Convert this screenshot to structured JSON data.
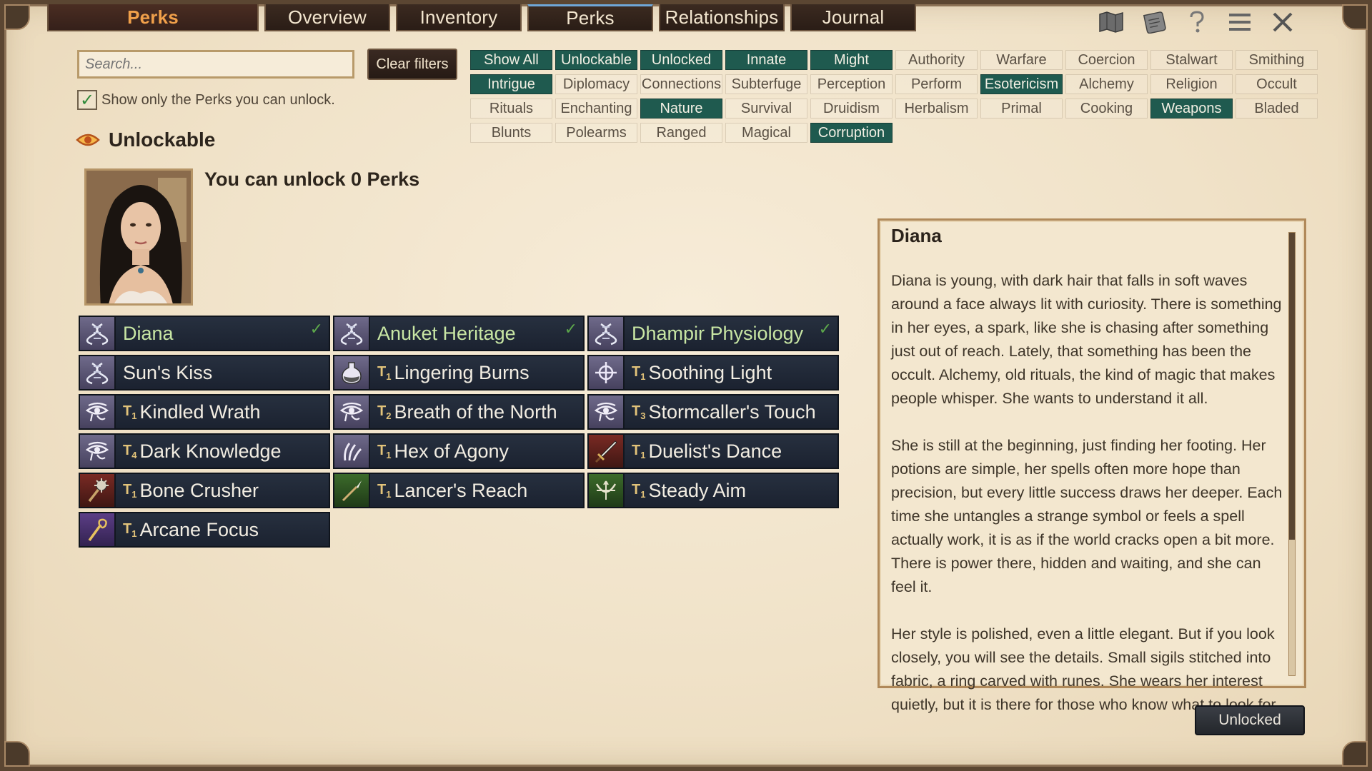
{
  "tabs": {
    "title": "Perks",
    "items": [
      "Overview",
      "Inventory",
      "Perks",
      "Relationships",
      "Journal"
    ]
  },
  "top_icons": [
    "map-icon",
    "scroll-icon",
    "help-icon",
    "menu-icon",
    "close-icon"
  ],
  "search": {
    "placeholder": "Search...",
    "value": ""
  },
  "clear_filters_label": "Clear filters",
  "only_unlock": {
    "label": "Show only the Perks you can unlock.",
    "checked": true
  },
  "filters": [
    {
      "label": "Show All",
      "on": true
    },
    {
      "label": "Unlockable",
      "on": true
    },
    {
      "label": "Unlocked",
      "on": true
    },
    {
      "label": "Innate",
      "on": true
    },
    {
      "label": "Might",
      "on": true
    },
    {
      "label": "Authority",
      "on": false
    },
    {
      "label": "Warfare",
      "on": false
    },
    {
      "label": "Coercion",
      "on": false
    },
    {
      "label": "Stalwart",
      "on": false
    },
    {
      "label": "Smithing",
      "on": false
    },
    {
      "label": "Intrigue",
      "on": true
    },
    {
      "label": "Diplomacy",
      "on": false
    },
    {
      "label": "Connections",
      "on": false
    },
    {
      "label": "Subterfuge",
      "on": false
    },
    {
      "label": "Perception",
      "on": false
    },
    {
      "label": "Perform",
      "on": false
    },
    {
      "label": "Esotericism",
      "on": true
    },
    {
      "label": "Alchemy",
      "on": false
    },
    {
      "label": "Religion",
      "on": false
    },
    {
      "label": "Occult",
      "on": false
    },
    {
      "label": "Rituals",
      "on": false
    },
    {
      "label": "Enchanting",
      "on": false
    },
    {
      "label": "Nature",
      "on": true
    },
    {
      "label": "Survival",
      "on": false
    },
    {
      "label": "Druidism",
      "on": false
    },
    {
      "label": "Herbalism",
      "on": false
    },
    {
      "label": "Primal",
      "on": false
    },
    {
      "label": "Cooking",
      "on": false
    },
    {
      "label": "Weapons",
      "on": true
    },
    {
      "label": "Bladed",
      "on": false
    },
    {
      "label": "Blunts",
      "on": false
    },
    {
      "label": "Polearms",
      "on": false
    },
    {
      "label": "Ranged",
      "on": false
    },
    {
      "label": "Magical",
      "on": false
    },
    {
      "label": "Corruption",
      "on": true
    }
  ],
  "section": {
    "title": "Unlockable",
    "icon": "eye-icon"
  },
  "unlock_count_text": "You can unlock 0 Perks",
  "perks": [
    {
      "name": "Diana",
      "tier": "",
      "icon": "dna-icon",
      "style": "",
      "unlocked": true
    },
    {
      "name": "Anuket Heritage",
      "tier": "",
      "icon": "dna-icon",
      "style": "",
      "unlocked": true
    },
    {
      "name": "Dhampir Physiology",
      "tier": "",
      "icon": "dna-icon",
      "style": "",
      "unlocked": true
    },
    {
      "name": "Sun's Kiss",
      "tier": "",
      "icon": "dna-icon",
      "style": "",
      "unlocked": false
    },
    {
      "name": "Lingering Burns",
      "tier": "1",
      "icon": "potion-icon",
      "style": "",
      "unlocked": false
    },
    {
      "name": "Soothing Light",
      "tier": "1",
      "icon": "holy-symbol-icon",
      "style": "",
      "unlocked": false
    },
    {
      "name": "Kindled Wrath",
      "tier": "1",
      "icon": "eye-of-horus-icon",
      "style": "",
      "unlocked": false
    },
    {
      "name": "Breath of the North",
      "tier": "2",
      "icon": "eye-of-horus-icon",
      "style": "",
      "unlocked": false
    },
    {
      "name": "Stormcaller's Touch",
      "tier": "3",
      "icon": "eye-of-horus-icon",
      "style": "",
      "unlocked": false
    },
    {
      "name": "Dark Knowledge",
      "tier": "4",
      "icon": "eye-of-horus-icon",
      "style": "",
      "unlocked": false
    },
    {
      "name": "Hex of Agony",
      "tier": "1",
      "icon": "claw-icon",
      "style": "",
      "unlocked": false
    },
    {
      "name": "Duelist's Dance",
      "tier": "1",
      "icon": "sword-icon",
      "style": "red",
      "unlocked": false
    },
    {
      "name": "Bone Crusher",
      "tier": "1",
      "icon": "mace-icon",
      "style": "red",
      "unlocked": false
    },
    {
      "name": "Lancer's Reach",
      "tier": "1",
      "icon": "spear-icon",
      "style": "green",
      "unlocked": false
    },
    {
      "name": "Steady Aim",
      "tier": "1",
      "icon": "bow-icon",
      "style": "green",
      "unlocked": false
    },
    {
      "name": "Arcane Focus",
      "tier": "1",
      "icon": "staff-icon",
      "style": "purple",
      "unlocked": false
    }
  ],
  "description": {
    "title": "Diana",
    "paragraphs": [
      "Diana is young, with dark hair that falls in soft waves around a face always lit with curiosity. There is something in her eyes, a spark, like she is chasing after something just out of reach. Lately, that something has been the occult. Alchemy, old rituals, the kind of magic that makes people whisper. She wants to understand it all.",
      "She is still at the beginning, just finding her footing. Her potions are simple, her spells often more hope than precision, but every little success draws her deeper. Each time she untangles a strange symbol or feels a spell actually work, it is as if the world cracks open a bit more. There is power there, hidden and waiting, and she can feel it.",
      "Her style is polished, even a little elegant. But if you look closely, you will see the details. Small sigils stitched into fabric, a ring carved with runes. She wears her interest quietly, but it is there for those who know what to look for."
    ]
  },
  "unlocked_button_label": "Unlocked",
  "colors": {
    "filter_on": "#1f5a4f",
    "perk_bg": "#1b2230",
    "tier": "#e2c37a",
    "unlocked_text": "#c8e6a4",
    "title_tab": "#f0a04a"
  }
}
